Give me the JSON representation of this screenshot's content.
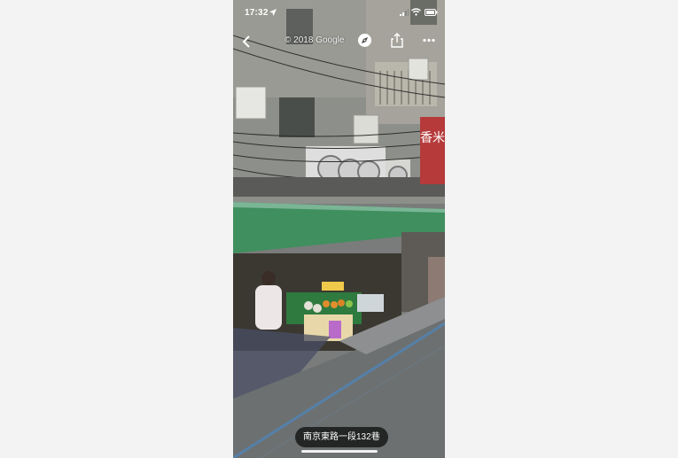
{
  "status_bar": {
    "time": "17:32",
    "location_icon": "location-arrow-icon",
    "signal_icon": "cellular-signal-icon",
    "wifi_icon": "wifi-icon",
    "battery_icon": "battery-icon"
  },
  "toolbar": {
    "back_icon": "chevron-left-icon",
    "copyright": "© 2018 Google",
    "compass_icon": "compass-icon",
    "share_icon": "share-icon",
    "more_icon": "ellipsis-icon"
  },
  "street_view": {
    "street_name": "南京東路一段132巷",
    "shop_sign": "香米"
  },
  "colors": {
    "awning": "#3f8f5f",
    "shop_sign": "#b63a3a",
    "label_bg": "#181818"
  }
}
